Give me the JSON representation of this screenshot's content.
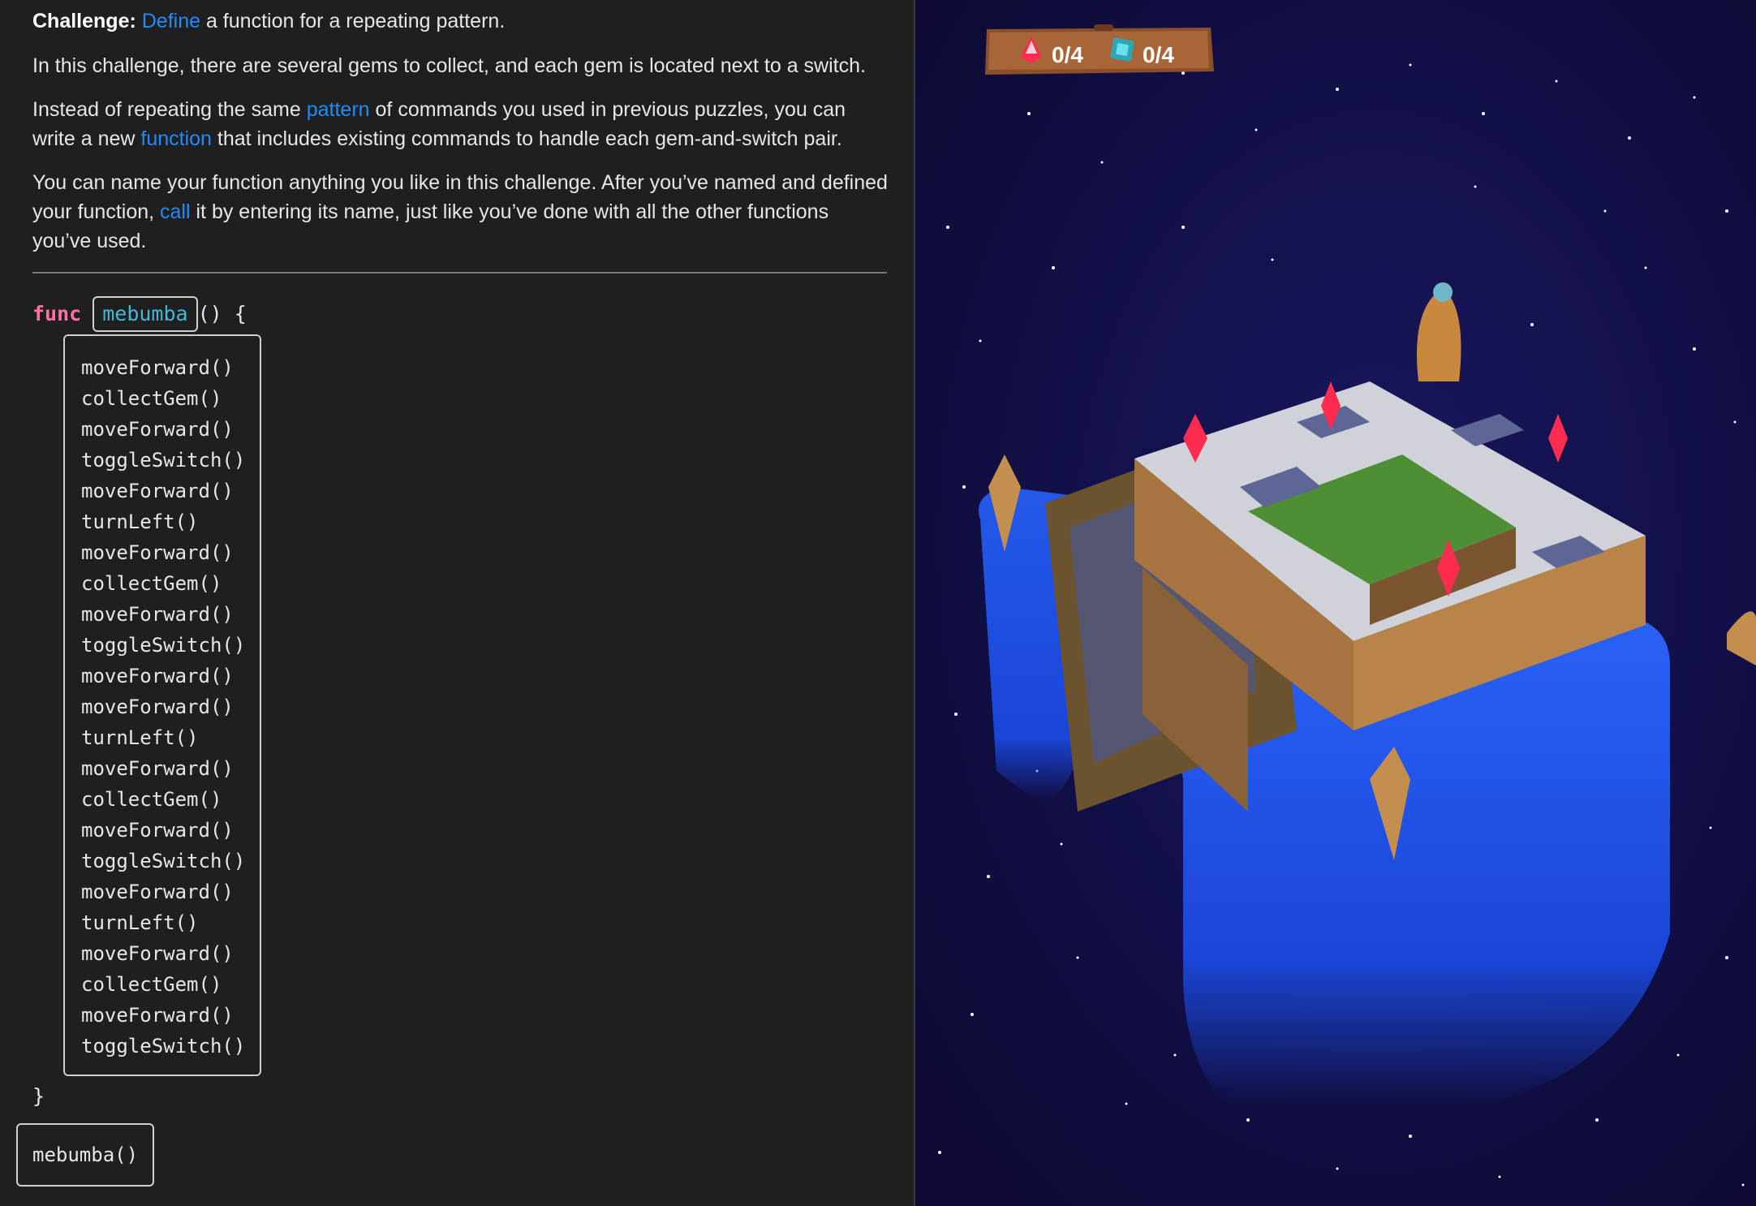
{
  "intro": {
    "challenge_label": "Challenge:",
    "p1_link": "Define",
    "p1_rest": " a function for a repeating pattern.",
    "p2": "In this challenge, there are several gems to collect, and each gem is located next to a switch.",
    "p3_a": "Instead of repeating the same ",
    "p3_link1": "pattern",
    "p3_b": " of commands you used in previous puzzles, you can write a new ",
    "p3_link2": "function",
    "p3_c": " that includes existing commands to handle each gem-and-switch pair.",
    "p4_a": "You can name your function anything you like in this challenge. After you’ve named and defined your function, ",
    "p4_link": "call",
    "p4_b": " it by entering its name, just like you’ve done with all the other functions you’ve used.",
    "link_color": "#1e8cff"
  },
  "code": {
    "keyword": "func",
    "func_name": "mebumba",
    "signature_rest": "() {",
    "body": [
      "moveForward()",
      "collectGem()",
      "moveForward()",
      "toggleSwitch()",
      "moveForward()",
      "turnLeft()",
      "moveForward()",
      "collectGem()",
      "moveForward()",
      "toggleSwitch()",
      "moveForward()",
      "moveForward()",
      "turnLeft()",
      "moveForward()",
      "collectGem()",
      "moveForward()",
      "toggleSwitch()",
      "moveForward()",
      "turnLeft()",
      "moveForward()",
      "collectGem()",
      "moveForward()",
      "toggleSwitch()"
    ],
    "closing": "}",
    "call": "mebumba()",
    "keyword_color": "#ff6fa8",
    "name_color": "#45b6d6"
  },
  "scene": {
    "hud": {
      "gem_icon": "red-gem-icon",
      "gem_count": "0/4",
      "switch_icon": "switch-icon",
      "switch_count": "0/4"
    },
    "colors": {
      "sky": "#0f0c3e",
      "water": "#1c4fe0",
      "gem": "#ff2c4f",
      "stone": "#c9ccd2",
      "dirt": "#a8743f",
      "grass": "#4f8f34"
    }
  }
}
